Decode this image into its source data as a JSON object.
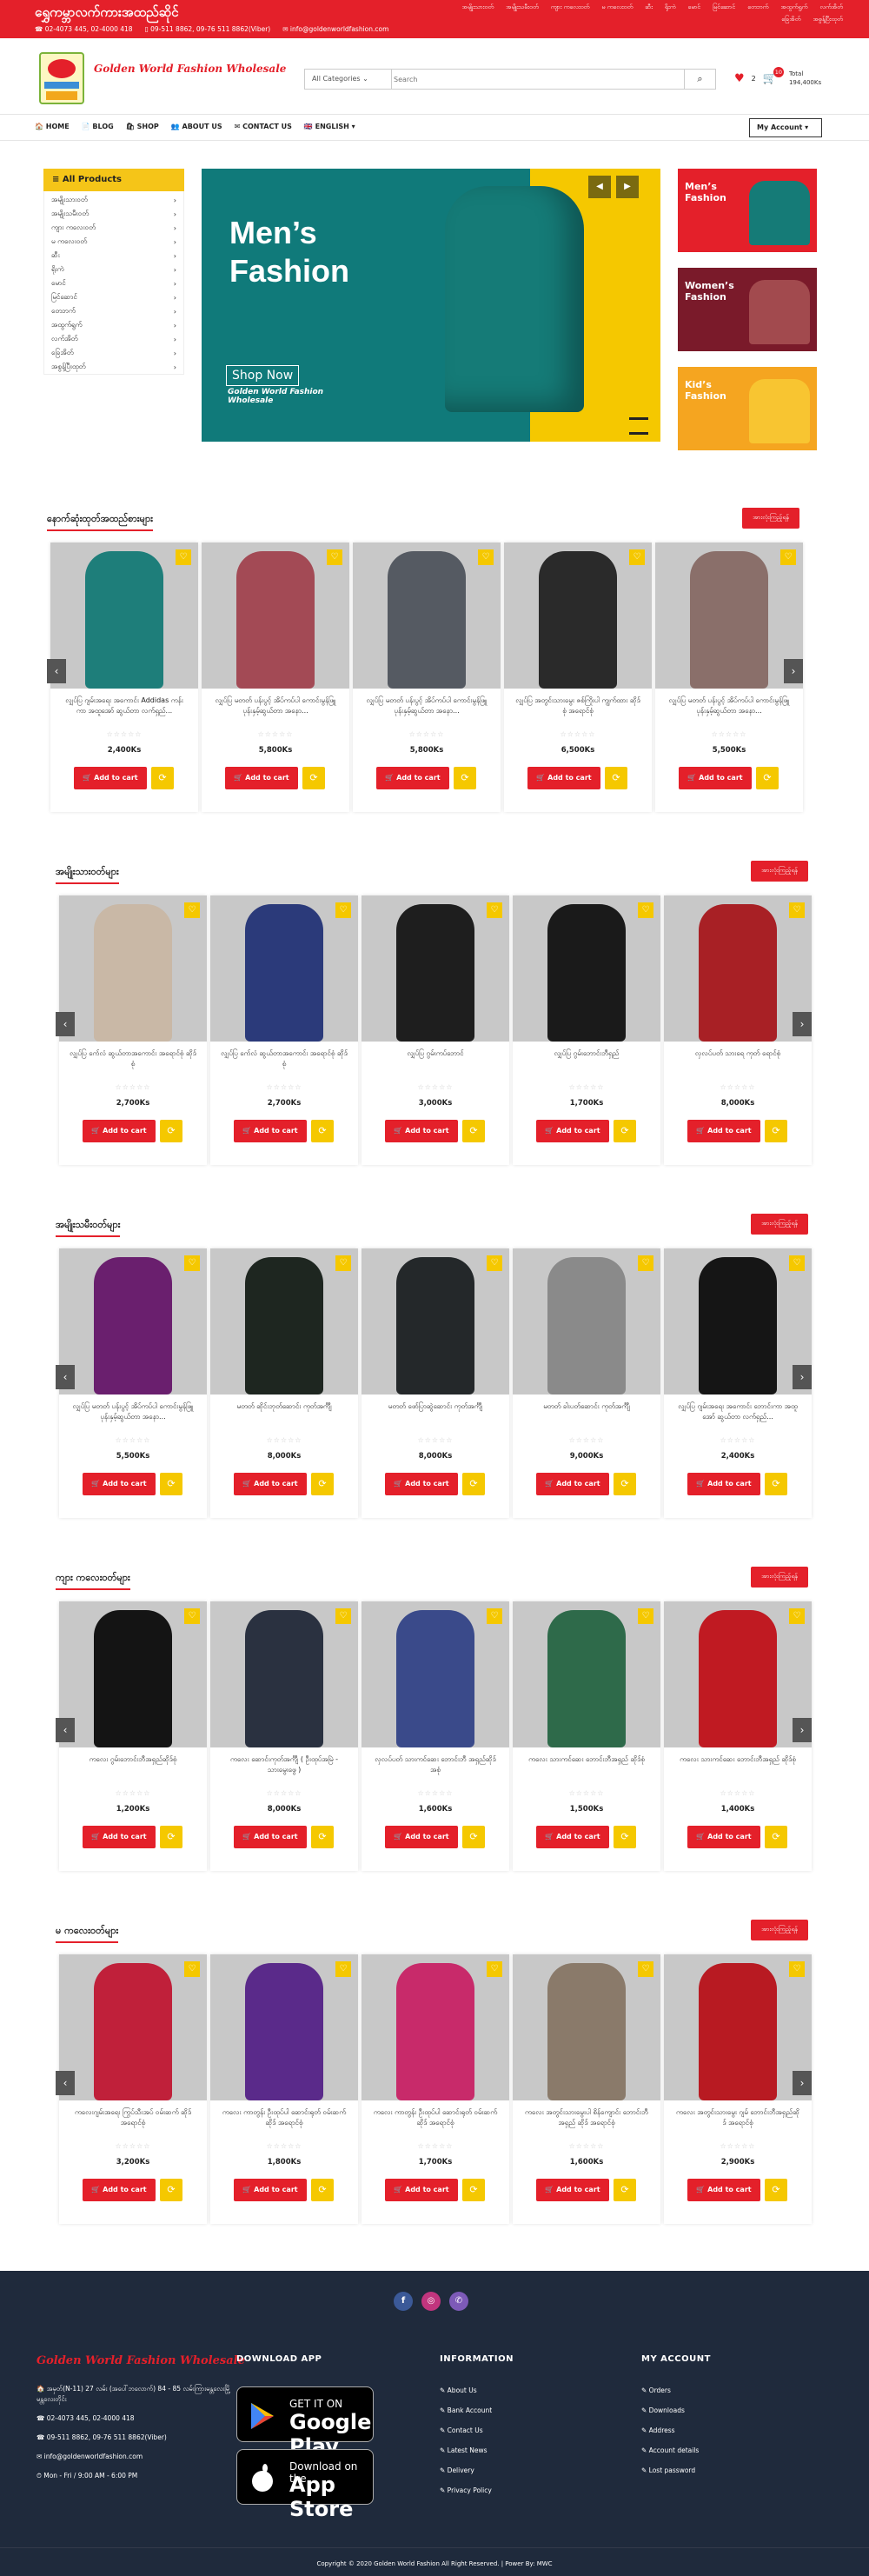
{
  "topbar": {
    "shop_name": "ရွှေကမ္ဘာလက်ကားအထည်ဆိုင်",
    "phone1": "☎ 02-4073 445, 02-4000 418",
    "phone2": "09-511 8862, 09-76 511 8862(Viber)",
    "email": "✉ info@goldenworldfashion.com",
    "nav": [
      "အမျိုးသားဝတ်",
      "အမျိုးသမီးဝတ်",
      "ကျား ကလေးဝတ်",
      "မ ကလေးဝတ်",
      "ဆီး",
      "ရိုးကဲ",
      "မောင်",
      "မြင်ဆောင်",
      "တေဘက်",
      "အထွက်ရွက်",
      "လက်အိတ်",
      "ခြေအိတ်",
      "အစွန့်ပြီးထုတ်"
    ]
  },
  "header": {
    "brand": "Golden World Fashion Wholesale",
    "search_category": "All Categories",
    "search_placeholder": "Search",
    "wish_count": "2",
    "cart_count": "10",
    "total_label": "Total",
    "total_value": "194,400Ks"
  },
  "nav": {
    "items": [
      "🏠 HOME",
      "📄 BLOG",
      "🛍 SHOP",
      "👥 ABOUT US",
      "✉ CONTACT US",
      "🇬🇧 ENGLISH ▾"
    ],
    "account": "My Account ▾"
  },
  "sidebar": {
    "title": "≡   All Products",
    "items": [
      "အမျိုးသားဝတ်",
      "အမျိုးသမီးဝတ်",
      "ကျား ကလေးဝတ်",
      "မ ကလေးဝတ်",
      "ဆီး",
      "ရိုးကဲ",
      "မောင်",
      "မြင်ဆောင်",
      "တေဘက်",
      "အထွက်ရွက်",
      "လက်အိတ်",
      "ခြေအိတ်",
      "အစွန့်ပြီးထုတ်"
    ]
  },
  "banner": {
    "title_line1": "Men’s",
    "title_line2": "Fashion",
    "shop_now": "Shop Now",
    "subtitle": "Golden World Fashion Wholesale"
  },
  "promos": [
    {
      "title": "Men’s Fashion",
      "bg": "#e4202a",
      "blob": "#157b77"
    },
    {
      "title": "Women’s Fashion",
      "bg": "#7a1a2a",
      "blob": "#a24a4e"
    },
    {
      "title": "Kid’s Fashion",
      "bg": "#f5a520",
      "blob": "#f8c531"
    }
  ],
  "colors": {
    "primary": "#e4202a",
    "accent": "#f5c800",
    "footer": "#1f2a3c"
  },
  "sections": [
    {
      "title": "နောက်ဆုံးထုတ်အထည်စားများ",
      "view_all": "အားလုံးကြည့်ရန်",
      "products": [
        {
          "name": "လျှပ်ပြ ဂျမ်းအရေး အကောင်း Addidas ကန်းကာ အထူအော် ဆွယ်တာ လက်ရှည်...",
          "price": "2,400Ks",
          "color": "#1e7e7a"
        },
        {
          "name": "လျှပ်ပြ မတတ် ပန်းပွင့် အိပ်ကပ်ပါ ကောင်းမွန်ဖြူ ပုန်းနှမ့်ဆွယ်တာ အနော...",
          "price": "5,800Ks",
          "color": "#a34a55"
        },
        {
          "name": "လျှပ်ပြ မတတ် ပန်းပွင့် အိပ်ကပ်ပါ ကောင်းမွန်ဖြူ ပုန်းနှမ့်ဆွယ်တာ အနော...",
          "price": "5,800Ks",
          "color": "#555a62"
        },
        {
          "name": "လျှပ်ပြ အတွင်းသားမွေး ဇစ်ကြိုးပါ ကျွက်ထား ဆိုဒ်စုံ အရောင်စုံ",
          "price": "6,500Ks",
          "color": "#2a2a2a"
        },
        {
          "name": "လျှပ်ပြ မတတ် ပန်းပွင့် အိပ်ကပ်ပါ ကောင်းမွန်ဖြူ ပုန်းနှမ့်ဆွယ်တာ အနော...",
          "price": "5,500Ks",
          "color": "#8a6f6a"
        }
      ]
    },
    {
      "title": "အမျိုးသားဝတ်များ",
      "view_all": "အားလုံးကြည့်ရန်",
      "products": [
        {
          "name": "လျှပ်ပြ ဂော်လံ ဆွယ်တာအကောင်း အရောင်စုံ ဆိုဒ်စုံ",
          "price": "2,700Ks",
          "color": "#c9b8a6"
        },
        {
          "name": "လျှပ်ပြ ဂော်လံ ဆွယ်တာအကောင်း အရောင်စုံ ဆိုဒ်စုံ",
          "price": "2,700Ks",
          "color": "#2b3a7a"
        },
        {
          "name": "လျှပ်ပြ ဂွမ်းကပ်ဘောင်",
          "price": "3,000Ks",
          "color": "#1e1e1e"
        },
        {
          "name": "လျှပ်ပြ ဂွမ်းဘောင်းဘီရှည်",
          "price": "1,700Ks",
          "color": "#1a1a1a"
        },
        {
          "name": "လှလပ်ပတ် သားရေ ကုတ် ရောင်စုံ",
          "price": "8,000Ks",
          "color": "#a82025"
        }
      ]
    },
    {
      "title": "အမျိုးသမီးဝတ်များ",
      "view_all": "အားလုံးကြည့်ရန်",
      "products": [
        {
          "name": "လျှပ်ပြ မတတ် ပန်းပွင့် အိပ်ကပ်ပါ ကောင်းမွန်ဖြူ ပုန်းနှမ့်ဆွယ်တာ အနော...",
          "price": "5,500Ks",
          "color": "#6a1f6e"
        },
        {
          "name": "မတတ် ဆိုင်းဘုတ်ဆောင်း ကုတ်အင်္ကျီ",
          "price": "8,000Ks",
          "color": "#1e2620"
        },
        {
          "name": "မတတ် ဖော်ပြာဆွဲဆောင်း ကုတ်အင်္ကျီ",
          "price": "8,000Ks",
          "color": "#24282a"
        },
        {
          "name": "မတတ် ခါးပတ်ဆောင်း ကုတ်အင်္ကျီ",
          "price": "9,000Ks",
          "color": "#8a8a8a"
        },
        {
          "name": "လျှပ်ပြ ဂျမ်းအရေး အကောင်း ဘောင်းကာ အထူအော် ဆွယ်တာ လက်ရှည်...",
          "price": "2,400Ks",
          "color": "#151515"
        }
      ]
    },
    {
      "title": "ကျား ကလေးဝတ်များ",
      "view_all": "အားလုံးကြည့်ရန်",
      "products": [
        {
          "name": "ကလေး ဂွမ်းဘောင်းဘီအရှည်ဆိုဒ်စုံ",
          "price": "1,200Ks",
          "color": "#141414"
        },
        {
          "name": "ကလေး ဆောင်းကုတ်အင်္ကျီ ( ဦးထုပ်အမြဲ - သားမွေးဖွေ )",
          "price": "8,000Ks",
          "color": "#2a3140"
        },
        {
          "name": "လှလပ်ပတ် သားကင်ဆေး ဘောင်းဘီ အရှည်ဆိုဒ်အစုံ",
          "price": "1,600Ks",
          "color": "#3a4a8a"
        },
        {
          "name": "ကလေး သားကင်ဆေး ဘောင်းဘီအရှည် ဆိုဒ်စုံ",
          "price": "1,500Ks",
          "color": "#2e6a4a"
        },
        {
          "name": "ကလေး သားကင်ဆေး ဘောင်းဘီအရှည် ဆိုဒ်စုံ",
          "price": "1,400Ks",
          "color": "#c01a22"
        }
      ]
    },
    {
      "title": "မ ကလေးဝတ်များ",
      "view_all": "အားလုံးကြည့်ရန်",
      "products": [
        {
          "name": "ကလေးဂျမ်းအရေး ကြွပ်သီးအပ် ဝမ်းဆက် ဆိုဒ် အရောင်စုံ",
          "price": "3,200Ks",
          "color": "#c0203a"
        },
        {
          "name": "ကလေး ကာတွန်း ဦးထုပ်ပါ ဆောင်းရုတ် ဝမ်းဆက် ဆိုဒ် အရောင်စုံ",
          "price": "1,800Ks",
          "color": "#5a2a8a"
        },
        {
          "name": "ကလေး ကာတွန်း ဦးထုပ်ပါ ဆောင်းရုတ် ဝမ်းဆက် ဆိုဒ် အရောင်စုံ",
          "price": "1,700Ks",
          "color": "#c82a6a"
        },
        {
          "name": "ကလေး အတွင်းသားမွေးပါ စိန်ကျောင်း ဘောင်းဘီအရှည် ဆိုဒ် အရောင်စုံ",
          "price": "1,600Ks",
          "color": "#8a7a6a"
        },
        {
          "name": "ကလေး အတွင်းသားမွေး ဂျမ် ဘောင်းဘီအရှည်ဆိုဒ် အရောင်စုံ",
          "price": "2,900Ks",
          "color": "#b81a22"
        }
      ]
    }
  ],
  "card": {
    "add_label": "Add to cart",
    "stars": "☆☆☆☆☆"
  },
  "footer": {
    "brand": "Golden World Fashion Wholesale",
    "address": "🏠 အမှတ်(N-11) 27 လမ်း (အပေါ်ဘလောက်) 84 - 85 လမ်းကြားမန္တလေးမြို့ မန္တလေးတိုင်း",
    "phone1": "☎ 02-4073 445, 02-4000 418",
    "phone2": "☎ 09-511 8862, 09-76 511 8862(Viber)",
    "email": "✉ info@goldenworldfashion.com",
    "hours": "⏱ Mon - Fri / 9:00 AM - 6:00 PM",
    "download_title": "DOWNLOAD APP",
    "gp_small": "GET IT ON",
    "gp_big": "Google Play",
    "as_small": "Download on the",
    "as_big": "App Store",
    "info_title": "INFORMATION",
    "info_items": [
      "About Us",
      "Bank Account",
      "Contact Us",
      "Latest News",
      "Delivery",
      "Privacy Policy"
    ],
    "acct_title": "MY ACCOUNT",
    "acct_items": [
      "Orders",
      "Downloads",
      "Address",
      "Account details",
      "Lost password"
    ],
    "copyright": "Copyright © 2020 Golden World Fashion All Right Reserved.  |  Power By: MWC"
  }
}
